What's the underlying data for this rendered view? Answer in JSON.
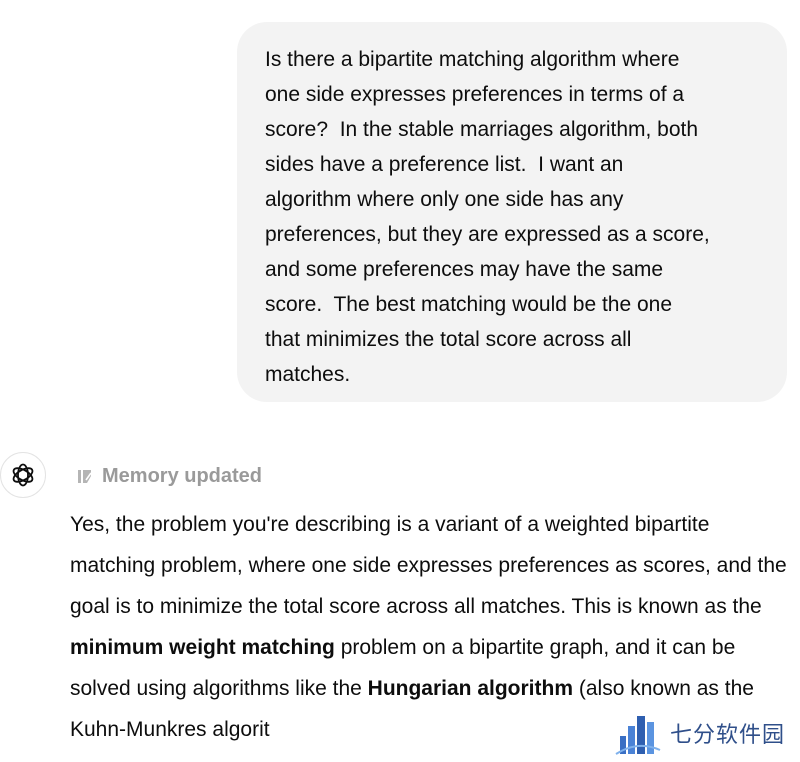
{
  "user_message": {
    "lines": [
      "Is there a bipartite matching algorithm where",
      "one side expresses preferences in terms of a",
      "score?  In the stable marriages algorithm, both",
      "sides have a preference list.  I want an",
      "algorithm where only one side has any",
      "preferences, but they are expressed as a score,",
      "and some preferences may have the same",
      "score.  The best matching would be the one",
      "that minimizes the total score across all",
      "matches."
    ]
  },
  "assistant": {
    "avatar_icon": "openai-logo-icon",
    "memory_status": {
      "icon": "memory-pencil-icon",
      "label": "Memory updated"
    },
    "response": {
      "p1": "Yes, the problem you're describing is a variant of a weighted bipartite matching problem, where one side expresses preferences as scores, and the goal is to minimize the total score across all matches. This is known as the ",
      "bold1": "minimum weight matching",
      "p2": " problem on a bipartite graph, and it can be solved using algorithms like the ",
      "bold2": "Hungarian algorithm",
      "p3": " (also known as the Kuhn-Munkres algorit"
    }
  },
  "watermark": {
    "icon": "building-logo-icon",
    "text": "七分软件园"
  },
  "colors": {
    "user_bubble_bg": "#f3f3f3",
    "text": "#0d0d0d",
    "muted": "#9a9a9a",
    "watermark": "#2f4f8a"
  }
}
